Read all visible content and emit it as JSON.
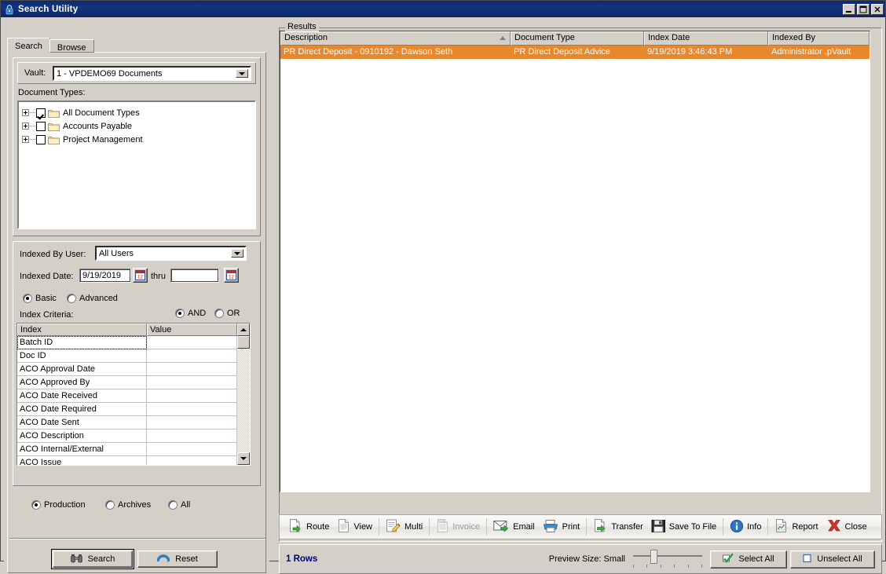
{
  "window": {
    "title": "Search Utility",
    "icon": "lock-icon",
    "controls": {
      "minimize": "_",
      "maximize": "□",
      "close": "✕"
    }
  },
  "tabs": [
    {
      "label": "Search",
      "active": true
    },
    {
      "label": "Browse",
      "active": false
    }
  ],
  "search_form": {
    "vault_label": "Vault:",
    "vault_value": "1 - VPDEMO69 Documents",
    "document_types_label": "Document Types:",
    "tree": [
      {
        "label": "All Document Types",
        "checked": true
      },
      {
        "label": "Accounts Payable",
        "checked": false
      },
      {
        "label": "Project Management",
        "checked": false
      }
    ],
    "indexed_by_user_label": "Indexed By User:",
    "indexed_by_user_value": "All Users",
    "indexed_date_label": "Indexed Date:",
    "indexed_date_from": "9/19/2019",
    "thru_label": "thru",
    "indexed_date_to": "",
    "mode_options": [
      {
        "label": "Basic",
        "selected": true
      },
      {
        "label": "Advanced",
        "selected": false
      }
    ],
    "index_criteria_label": "Index Criteria:",
    "logic_options": [
      {
        "label": "AND",
        "selected": true
      },
      {
        "label": "OR",
        "selected": false
      }
    ],
    "criteria_columns": [
      "Index",
      "Value"
    ],
    "criteria_rows": [
      {
        "index": "Batch ID",
        "value": "",
        "selected": true
      },
      {
        "index": "Doc ID",
        "value": "",
        "selected": false
      },
      {
        "index": "ACO Approval Date",
        "value": "",
        "selected": false
      },
      {
        "index": "ACO Approved By",
        "value": "",
        "selected": false
      },
      {
        "index": "ACO Date Received",
        "value": "",
        "selected": false
      },
      {
        "index": "ACO Date Required",
        "value": "",
        "selected": false
      },
      {
        "index": "ACO Date Sent",
        "value": "",
        "selected": false
      },
      {
        "index": "ACO Description",
        "value": "",
        "selected": false
      },
      {
        "index": "ACO Internal/External",
        "value": "",
        "selected": false
      },
      {
        "index": "ACO Issue",
        "value": "",
        "selected": false
      }
    ],
    "scope_options": [
      {
        "label": "Production",
        "selected": true
      },
      {
        "label": "Archives",
        "selected": false
      },
      {
        "label": "All",
        "selected": false
      }
    ],
    "search_button": "Search",
    "reset_button": "Reset"
  },
  "results": {
    "legend": "Results",
    "columns": [
      {
        "label": "Description",
        "sorted": true
      },
      {
        "label": "Document Type",
        "sorted": false
      },
      {
        "label": "Index Date",
        "sorted": false
      },
      {
        "label": "Indexed By",
        "sorted": false
      }
    ],
    "rows": [
      {
        "description": "PR Direct Deposit -   0910192 - Dawson Seth",
        "document_type": "PR Direct Deposit Advice",
        "index_date": "9/19/2019 3:46:43 PM",
        "indexed_by": "Administrator ,pVault",
        "selected": true
      }
    ],
    "selection_color": "#e8882e"
  },
  "toolbar": [
    {
      "label": "Route",
      "icon": "route-icon",
      "enabled": true
    },
    {
      "label": "View",
      "icon": "view-icon",
      "enabled": true
    },
    {
      "label": "Multi",
      "icon": "multi-icon",
      "enabled": true
    },
    {
      "label": "Invoice",
      "icon": "invoice-icon",
      "enabled": false
    },
    {
      "label": "Email",
      "icon": "email-icon",
      "enabled": true
    },
    {
      "label": "Print",
      "icon": "print-icon",
      "enabled": true
    },
    {
      "label": "Transfer",
      "icon": "transfer-icon",
      "enabled": true
    },
    {
      "label": "Save To File",
      "icon": "save-icon",
      "enabled": true
    },
    {
      "label": "Info",
      "icon": "info-icon",
      "enabled": true
    },
    {
      "label": "Report",
      "icon": "report-icon",
      "enabled": true
    },
    {
      "label": "Close",
      "icon": "close-x-icon",
      "enabled": true
    }
  ],
  "status": {
    "rows_label": "1 Rows",
    "preview_size_label": "Preview Size: Small",
    "select_all": "Select All",
    "unselect_all": "Unselect All"
  }
}
